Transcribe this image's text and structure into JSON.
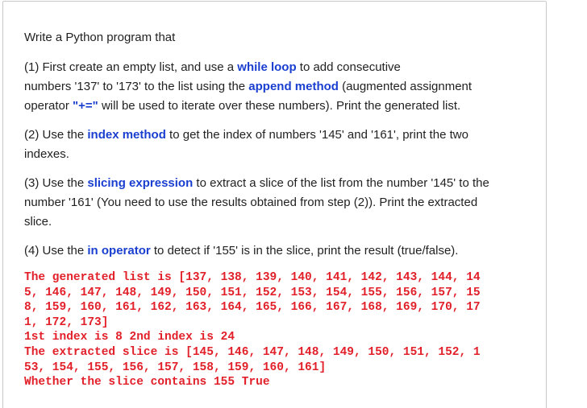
{
  "intro": "Write a Python program that",
  "steps": [
    {
      "prefix": "(1) First create an empty list, and use a ",
      "kw1": "while loop",
      "mid1": " to add consecutive",
      "line2a": "numbers '137' to '173' to the list using the ",
      "kw2": "append method",
      "line2b": " (augmented assignment",
      "line3a": "operator ",
      "kw3": "\"+=\"",
      "line3b": " will be used to iterate over these numbers). Print the generated list."
    },
    {
      "prefix": "(2) Use the ",
      "kw1": "index method",
      "rest1": " to get the index of numbers '145' and '161', print the two",
      "line2": "indexes."
    },
    {
      "prefix": "(3) Use the ",
      "kw1": "slicing expression",
      "rest1": " to extract a slice of the list from the number '145' to the",
      "line2": "number '161' (You need to use the results obtained from step (2)). Print the extracted",
      "line3": "slice."
    },
    {
      "prefix": "(4) Use the ",
      "kw1": "in operator",
      "rest1": " to detect if '155' is in the slice, print the result (true/false)."
    }
  ],
  "output_lines": [
    "The generated list is [137, 138, 139, 140, 141, 142, 143, 144, 14",
    "5, 146, 147, 148, 149, 150, 151, 152, 153, 154, 155, 156, 157, 15",
    "8, 159, 160, 161, 162, 163, 164, 165, 166, 167, 168, 169, 170, 17",
    "1, 172, 173]",
    "1st index is 8 2nd index is 24",
    "The extracted slice is [145, 146, 147, 148, 149, 150, 151, 152, 1",
    "53, 154, 155, 156, 157, 158, 159, 160, 161]",
    "Whether the slice contains 155 True"
  ],
  "colors": {
    "keyword": "#1a3fd0",
    "output": "#e2202a",
    "text": "#222222",
    "border": "#c9c9c9"
  }
}
